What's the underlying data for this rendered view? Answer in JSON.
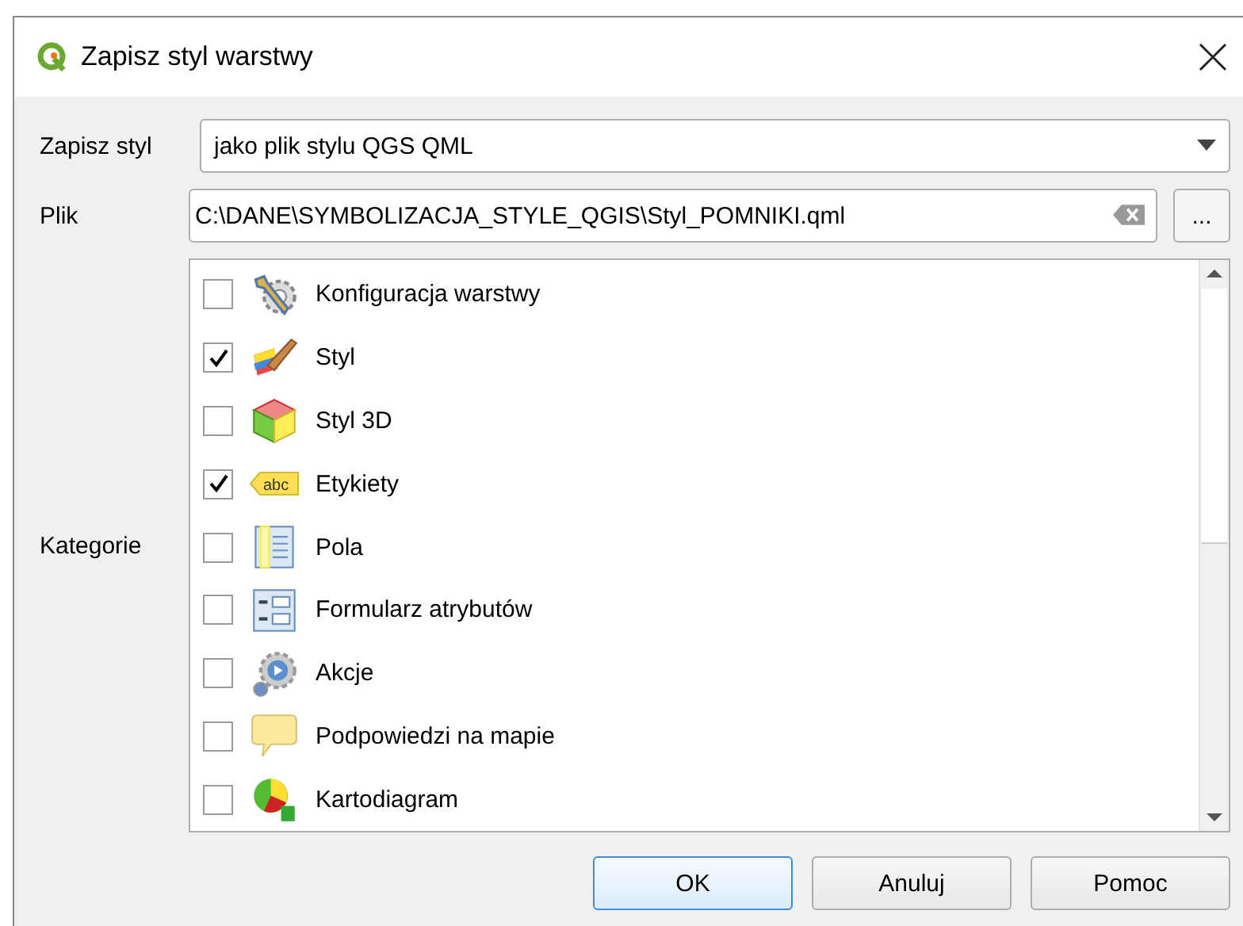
{
  "window": {
    "title": "Zapisz styl warstwy"
  },
  "form": {
    "style_label": "Zapisz styl",
    "style_value": "jako plik stylu QGS QML",
    "file_label": "Plik",
    "file_value": "C:\\DANE\\SYMBOLIZACJA_STYLE_QGIS\\Styl_POMNIKI.qml",
    "browse": "...",
    "categories_label": "Kategorie"
  },
  "categories": [
    {
      "label": "Konfiguracja warstwy",
      "kind": "wrench",
      "checked": false
    },
    {
      "label": "Styl",
      "kind": "brush",
      "checked": true
    },
    {
      "label": "Styl 3D",
      "kind": "cube",
      "checked": false
    },
    {
      "label": "Etykiety",
      "kind": "label",
      "icon_text": "abc",
      "checked": true
    },
    {
      "label": "Pola",
      "kind": "fields",
      "checked": false
    },
    {
      "label": "Formularz atrybutów",
      "kind": "form",
      "checked": false
    },
    {
      "label": "Akcje",
      "kind": "actions",
      "checked": false
    },
    {
      "label": "Podpowiedzi na mapie",
      "kind": "tooltip",
      "checked": false
    },
    {
      "label": "Kartodiagram",
      "kind": "diagram",
      "checked": false
    }
  ],
  "buttons": [
    "OK",
    "Anuluj",
    "Pomoc"
  ]
}
